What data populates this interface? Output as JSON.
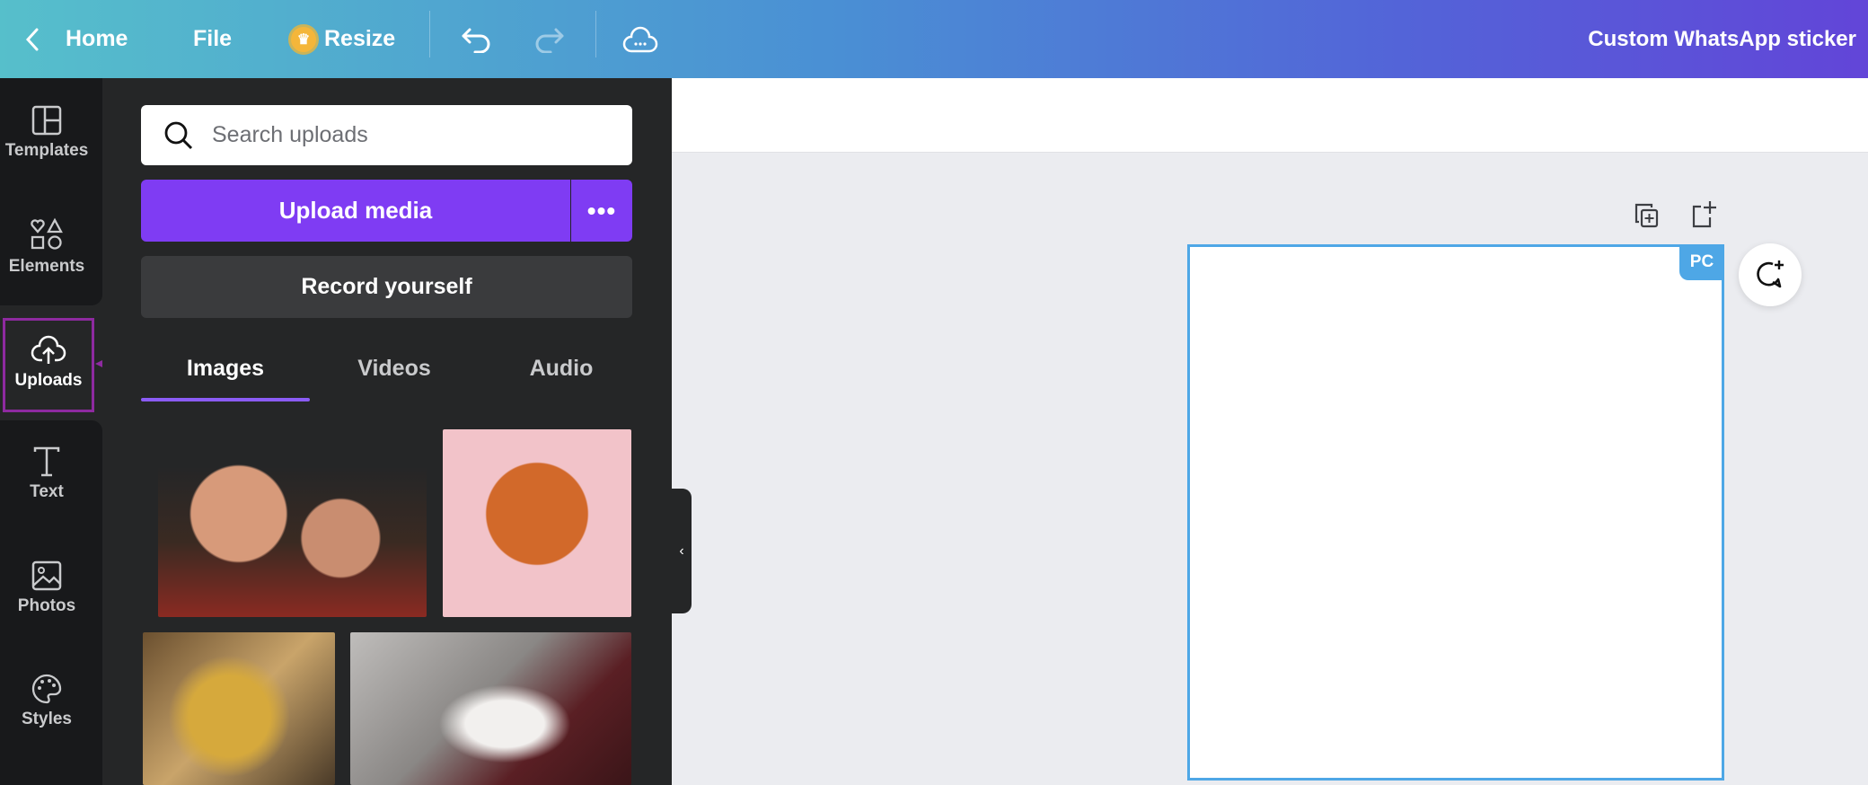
{
  "topbar": {
    "back_icon": "chevron-left-icon",
    "home": "Home",
    "file": "File",
    "resize": "Resize",
    "title": "Custom WhatsApp sticker"
  },
  "rail": {
    "items": [
      {
        "label": "Templates",
        "icon": "templates-icon"
      },
      {
        "label": "Elements",
        "icon": "elements-icon"
      },
      {
        "label": "Uploads",
        "icon": "cloud-upload-icon"
      },
      {
        "label": "Text",
        "icon": "text-icon"
      },
      {
        "label": "Photos",
        "icon": "photos-icon"
      },
      {
        "label": "Styles",
        "icon": "palette-icon"
      }
    ]
  },
  "panel": {
    "search_placeholder": "Search uploads",
    "upload_label": "Upload media",
    "more_label": "•••",
    "record_label": "Record yourself",
    "tabs": [
      {
        "label": "Images",
        "active": true
      },
      {
        "label": "Videos"
      },
      {
        "label": "Audio"
      }
    ]
  },
  "canvas": {
    "page_badge": "PC"
  },
  "colors": {
    "accent": "#7f3cf3",
    "selection": "#4ea7e6",
    "highlight": "#8e2aa0"
  }
}
